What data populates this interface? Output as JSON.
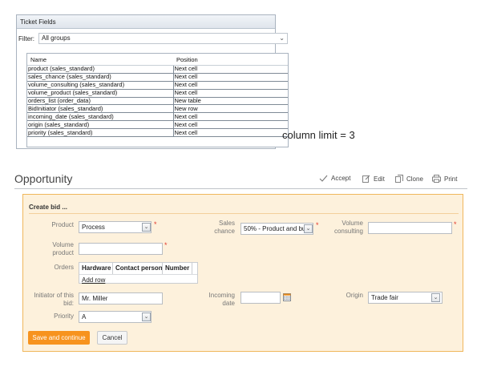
{
  "ticket_fields": {
    "title": "Ticket Fields",
    "filter_label": "Filter:",
    "filter_value": "All groups",
    "columns": [
      "Name",
      "Position"
    ],
    "rows": [
      {
        "name": "product (sales_standard)",
        "position": "Next cell"
      },
      {
        "name": "sales_chance (sales_standard)",
        "position": "Next cell"
      },
      {
        "name": "volume_consulting (sales_standard)",
        "position": "Next cell"
      },
      {
        "name": "volume_product (sales_standard)",
        "position": "Next cell"
      },
      {
        "name": "orders_list (order_data)",
        "position": "New table"
      },
      {
        "name": "BidInitiator (sales_standard)",
        "position": "New row"
      },
      {
        "name": "incoming_date (sales_standard)",
        "position": "Next cell"
      },
      {
        "name": "origin (sales_standard)",
        "position": "Next cell"
      },
      {
        "name": "priority (sales_standard)",
        "position": "Next cell"
      }
    ]
  },
  "annotation": "column limit = 3",
  "opportunity": {
    "title": "Opportunity",
    "actions": {
      "accept": "Accept",
      "edit": "Edit",
      "clone": "Clone",
      "print": "Print"
    }
  },
  "form": {
    "heading": "Create bid ...",
    "product": {
      "label": "Product",
      "value": "Process"
    },
    "sales_chance": {
      "label_line1": "Sales",
      "label_line2": "chance",
      "value": "50% - Product and bu"
    },
    "volume_consulting": {
      "label_line1": "Volume",
      "label_line2": "consulting",
      "value": ""
    },
    "volume_product": {
      "label_line1": "Volume",
      "label_line2": "product",
      "value": ""
    },
    "orders": {
      "label": "Orders",
      "columns": [
        "Hardware",
        "Contact person",
        "Number"
      ],
      "add_row": "Add row"
    },
    "initiator": {
      "label_line1": "Initiator of this",
      "label_line2": "bid:",
      "value": "Mr. Miller"
    },
    "incoming_date": {
      "label_line1": "Incoming",
      "label_line2": "date",
      "value": ""
    },
    "origin": {
      "label": "Origin",
      "value": "Trade fair"
    },
    "priority": {
      "label": "Priority",
      "value": "A"
    },
    "required_mark": "*",
    "save_label": "Save and continue",
    "cancel_label": "Cancel"
  },
  "colors": {
    "accent": "#f7931e",
    "panel_bg": "#fdf1dc",
    "panel_border": "#f0b75c",
    "required": "#e33a2c"
  },
  "icons": [
    "chevron-down-icon",
    "accept-icon",
    "edit-icon",
    "clone-icon",
    "print-icon",
    "calendar-icon"
  ]
}
